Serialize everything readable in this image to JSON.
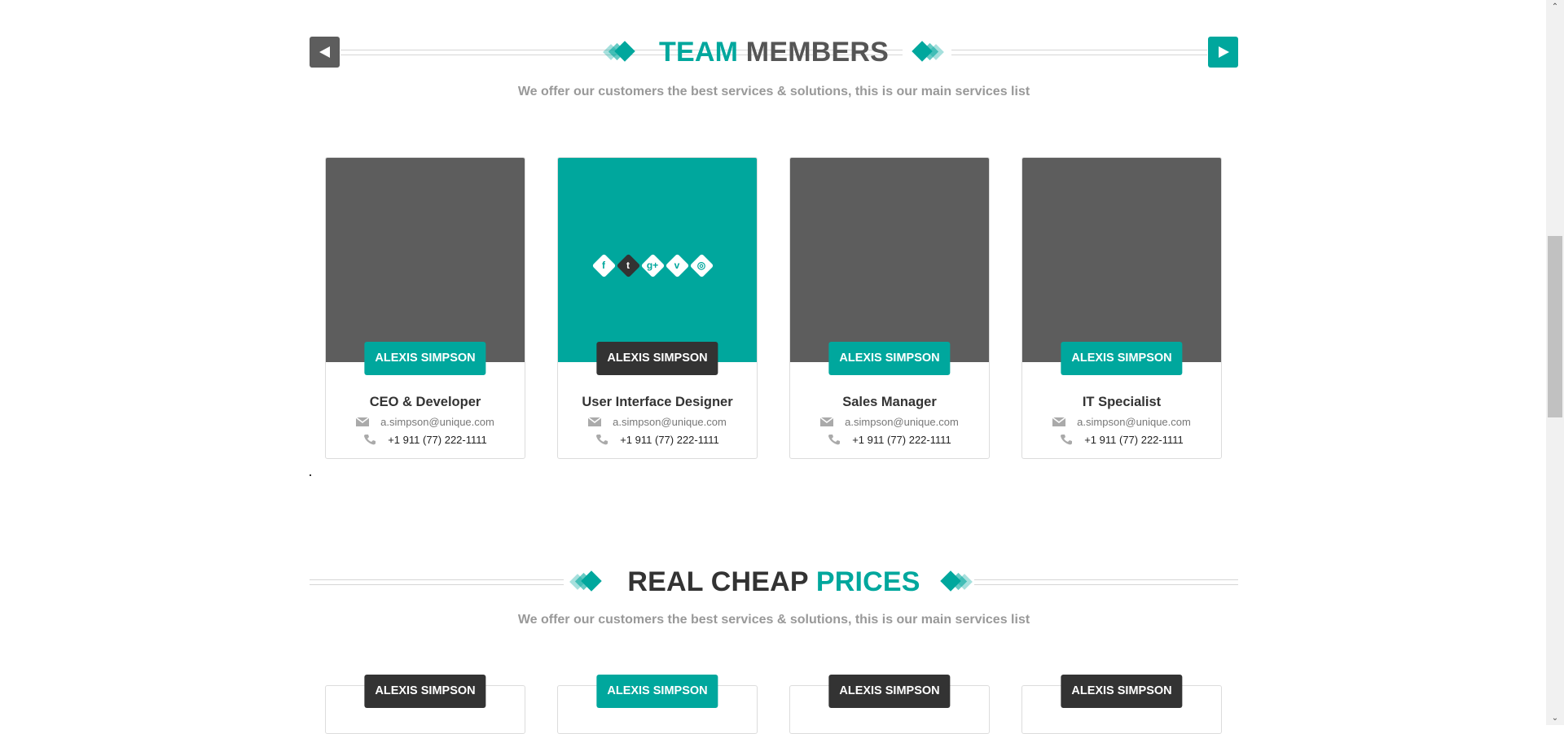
{
  "team_section": {
    "title_accent": "TEAM",
    "title_rest": "MEMBERS",
    "subtitle": "We offer our customers the best services & solutions, this is our main services list",
    "prev_icon": "triangle-left-icon",
    "next_icon": "triangle-right-icon",
    "members": [
      {
        "name": "ALEXIS SIMPSON",
        "role": "CEO & Developer",
        "email": "a.simpson@unique.com",
        "phone": "+1 911 (77) 222-1111"
      },
      {
        "name": "ALEXIS SIMPSON",
        "role": "User Interface Designer",
        "email": "a.simpson@unique.com",
        "phone": "+1 911 (77) 222-1111"
      },
      {
        "name": "ALEXIS SIMPSON",
        "role": "Sales Manager",
        "email": "a.simpson@unique.com",
        "phone": "+1 911 (77) 222-1111"
      },
      {
        "name": "ALEXIS SIMPSON",
        "role": "IT Specialist",
        "email": "a.simpson@unique.com",
        "phone": "+1 911 (77) 222-1111"
      }
    ],
    "social_icons": [
      {
        "icon": "facebook-icon",
        "glyph": "f"
      },
      {
        "icon": "twitter-icon",
        "glyph": "t"
      },
      {
        "icon": "google-plus-icon",
        "glyph": "g+"
      },
      {
        "icon": "vimeo-icon",
        "glyph": "v"
      },
      {
        "icon": "dribbble-icon",
        "glyph": "◎"
      }
    ]
  },
  "pricing_section": {
    "title_dark": "REAL CHEAP",
    "title_accent": "PRICES",
    "subtitle": "We offer our customers the best services & solutions, this is our main services list",
    "plans": [
      {
        "name": "ALEXIS SIMPSON"
      },
      {
        "name": "ALEXIS SIMPSON"
      },
      {
        "name": "ALEXIS SIMPSON"
      },
      {
        "name": "ALEXIS SIMPSON"
      }
    ]
  },
  "colors": {
    "accent": "#00a79d",
    "dark": "#333333",
    "gray": "#5d5d5d",
    "subtitle": "#999999"
  }
}
